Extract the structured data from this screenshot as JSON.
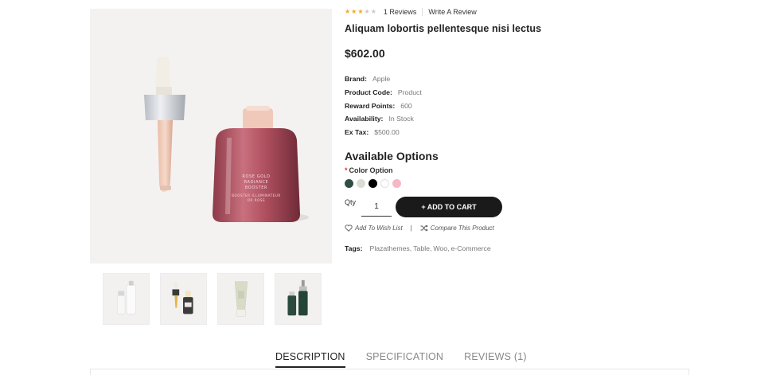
{
  "product": {
    "rating": 3,
    "rating_max": 5,
    "reviews_link": "1 Reviews",
    "write_review_link": "Write A Review",
    "title": "Aliquam lobortis pellentesque nisi lectus",
    "price": "$602.00",
    "meta": [
      {
        "label": "Brand:",
        "value": "Apple"
      },
      {
        "label": "Product Code:",
        "value": "Product"
      },
      {
        "label": "Reward Points:",
        "value": "600"
      },
      {
        "label": "Availability:",
        "value": "In Stock"
      },
      {
        "label": "Ex Tax:",
        "value": "$500.00"
      }
    ],
    "bottle_label_lines": [
      "ROSE GOLD",
      "RADIANCE",
      "BOOSTER",
      "BOOSTER ILLUMINATEUR",
      "OR ROSE"
    ]
  },
  "options": {
    "heading": "Available Options",
    "required_mark": "*",
    "color_label": "Color Option",
    "colors": [
      "#2f4f46",
      "#d9dcd3",
      "#000000",
      "#ffffff",
      "#f4b9c4"
    ]
  },
  "cart": {
    "qty_label": "Qty",
    "qty_value": "1",
    "add_to_cart_label": "+ ADD TO CART"
  },
  "actions": {
    "wishlist_label": "Add To Wish List",
    "separator": "|",
    "compare_label": "Compare This Product"
  },
  "tags": {
    "label": "Tags:",
    "items": [
      "Plazathemes",
      "Table",
      "Woo",
      "e-Commerce"
    ]
  },
  "tabs": [
    {
      "label": "DESCRIPTION",
      "active": true
    },
    {
      "label": "SPECIFICATION",
      "active": false
    },
    {
      "label": "REVIEWS (1)",
      "active": false
    }
  ],
  "colors": {
    "star_active": "#f5a623",
    "star_inactive": "#c8c8c8",
    "button_bg": "#1a1a1a",
    "bottle_rose": "#b0505f"
  }
}
